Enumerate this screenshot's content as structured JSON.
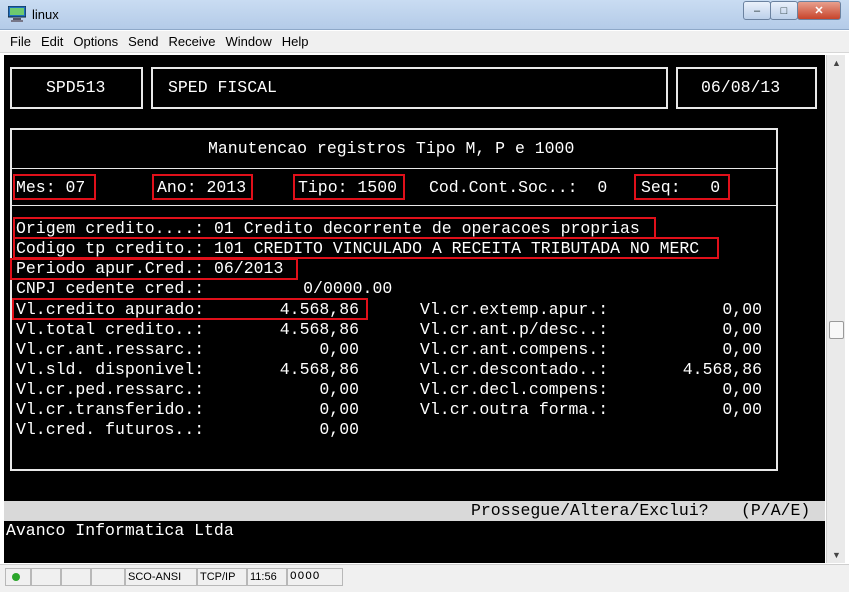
{
  "window": {
    "title": "linux",
    "controls": {
      "minimize": "–",
      "maximize": "□",
      "close": "✕"
    }
  },
  "menu": [
    "File",
    "Edit",
    "Options",
    "Send",
    "Receive",
    "Window",
    "Help"
  ],
  "header": {
    "program": "SPD513",
    "system": "SPED FISCAL",
    "date": "06/08/13"
  },
  "screen_title": "Manutencao registros Tipo M, P e 1000",
  "keys": {
    "mes": "Mes: 07",
    "ano": "Ano: 2013",
    "tipo": "Tipo: 1500",
    "cod_cont_soc": "Cod.Cont.Soc..:  0",
    "seq": "Seq:   0"
  },
  "info_lines": {
    "origem": "Origem credito....: 01 Credito decorrente de operacoes proprias",
    "codigo": "Codigo tp credito.: 101 CREDITO VINCULADO A RECEITA TRIBUTADA NO MERC",
    "periodo": "Periodo apur.Cred.: 06/2013",
    "cnpj": "CNPJ cedente cred.:          0/0000.00"
  },
  "values_left": [
    {
      "label": "Vl.credito apurado:",
      "value": "4.568,86"
    },
    {
      "label": "Vl.total credito..:",
      "value": "4.568,86"
    },
    {
      "label": "Vl.cr.ant.ressarc.:",
      "value": "0,00"
    },
    {
      "label": "Vl.sld. disponivel:",
      "value": "4.568,86"
    },
    {
      "label": "Vl.cr.ped.ressarc.:",
      "value": "0,00"
    },
    {
      "label": "Vl.cr.transferido.:",
      "value": "0,00"
    },
    {
      "label": "Vl.cred. futuros..:",
      "value": "0,00"
    }
  ],
  "values_right": [
    {
      "label": "Vl.cr.extemp.apur.:",
      "value": "0,00"
    },
    {
      "label": "Vl.cr.ant.p/desc..:",
      "value": "0,00"
    },
    {
      "label": "Vl.cr.ant.compens.:",
      "value": "0,00"
    },
    {
      "label": "Vl.cr.descontado..:",
      "value": "4.568,86"
    },
    {
      "label": "Vl.cr.decl.compens:",
      "value": "0,00"
    },
    {
      "label": "Vl.cr.outra forma.:",
      "value": "0,00"
    }
  ],
  "prompt": {
    "question": "Prossegue/Altera/Exclui?",
    "options": "(P/A/E)"
  },
  "footer_company": "Avanco Informatica Ltda",
  "statusbar": {
    "emulation": "SCO-ANSI",
    "protocol": "TCP/IP",
    "time": "11:56",
    "leds": "OOOO"
  },
  "colors": {
    "terminal_bg": "#000000",
    "terminal_fg": "#ffffff",
    "highlight": "#e0101a",
    "status_strip": "#d9d9d9"
  }
}
